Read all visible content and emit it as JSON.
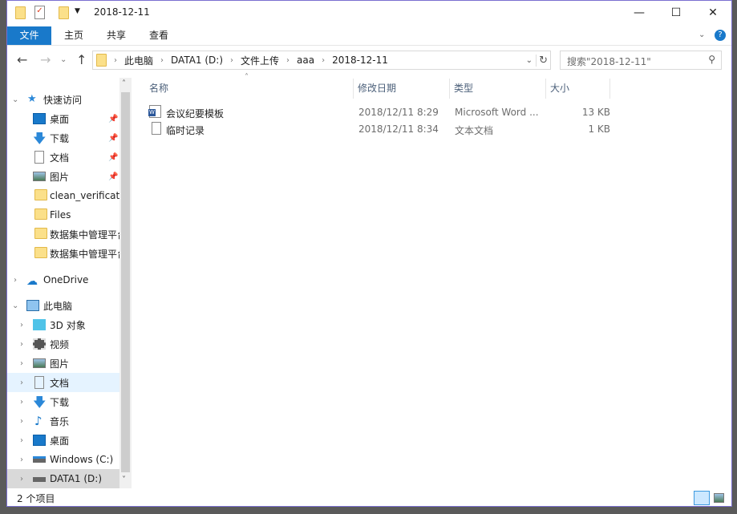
{
  "window": {
    "title": "2018-12-11",
    "minimize": "—",
    "maximize": "☐",
    "close": "✕"
  },
  "ribbon": {
    "tabs": [
      "文件",
      "主页",
      "共享",
      "查看"
    ],
    "help": "?"
  },
  "address": {
    "crumbs": [
      "此电脑",
      "DATA1 (D:)",
      "文件上传",
      "aaa",
      "2018-12-11"
    ],
    "search_placeholder": "搜索\"2018-12-11\""
  },
  "nav": {
    "quick_access": "快速访问",
    "quick_items": [
      "桌面",
      "下载",
      "文档",
      "图片",
      "clean_verificatio",
      "Files",
      "数据集中管理平台",
      "数据集中管理平台"
    ],
    "onedrive": "OneDrive",
    "this_pc": "此电脑",
    "pc_items": [
      "3D 对象",
      "视频",
      "图片",
      "文档",
      "下载",
      "音乐",
      "桌面",
      "Windows (C:)",
      "DATA1 (D:)"
    ]
  },
  "columns": [
    "名称",
    "修改日期",
    "类型",
    "大小"
  ],
  "files": [
    {
      "name": "会议纪要模板",
      "modified": "2018/12/11 8:29",
      "type": "Microsoft Word ...",
      "size": "13 KB",
      "icon": "word-doc-icon"
    },
    {
      "name": "临时记录",
      "modified": "2018/12/11 8:34",
      "type": "文本文档",
      "size": "1 KB",
      "icon": "text-doc-icon"
    }
  ],
  "status": {
    "count": "2 个项目"
  }
}
